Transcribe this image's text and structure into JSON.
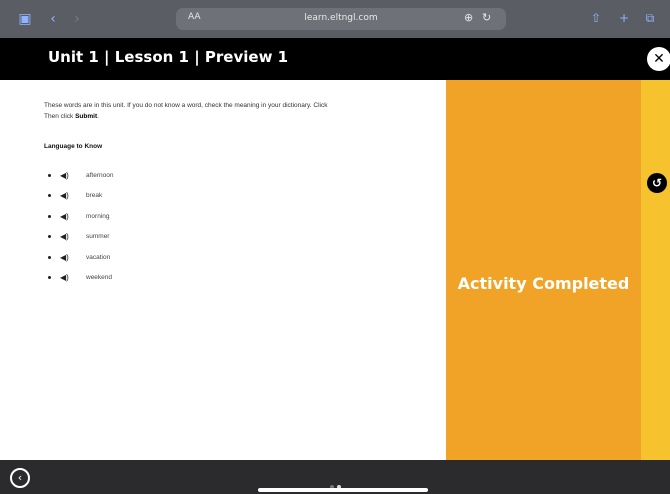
{
  "browser": {
    "text_size_label": "AA",
    "url": "learn.eltngl.com",
    "accent_color": "#8fb4ff"
  },
  "lesson": {
    "title": "Unit 1 | Lesson 1 | Preview 1"
  },
  "instructions": {
    "line1": "These words are in this unit. If you do not know a word, check the meaning in your dictionary. Click",
    "line2_prefix": "Then click ",
    "line2_bold": "Submit",
    "line2_suffix": "."
  },
  "language_to_know": {
    "heading": "Language to Know",
    "words": [
      "afternoon",
      "break",
      "morning",
      "summer",
      "vacation",
      "weekend"
    ]
  },
  "overlay": {
    "status_text": "Activity Completed",
    "panel_color": "#f0a327",
    "edge_color": "#f6c22e"
  },
  "pager": {
    "page_count": 2,
    "current_page": 2
  }
}
